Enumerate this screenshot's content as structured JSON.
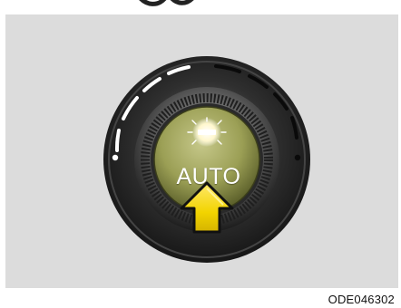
{
  "figure": {
    "button_label": "AUTO",
    "figure_code": "ODE046302"
  },
  "colors": {
    "background": "#dcdcdc",
    "knob_face": "#9b9f55",
    "arrow_fill": "#f2d400",
    "indicator_light": "#ffffff"
  },
  "icons": {
    "indicator": "indicator-light-icon",
    "arrow": "press-arrow-icon"
  }
}
